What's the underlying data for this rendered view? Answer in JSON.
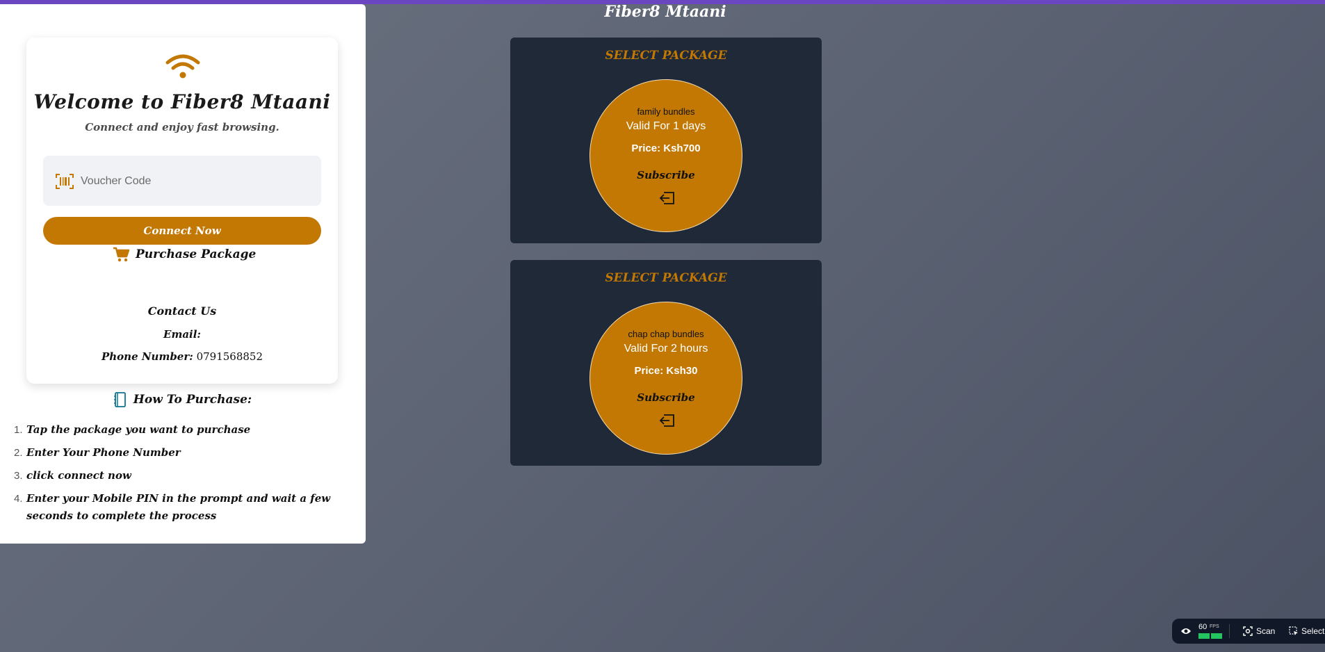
{
  "colors": {
    "accent": "#c27803",
    "card_bg": "#1f2937",
    "top_strip": "#6b46c1"
  },
  "login": {
    "title": "Welcome to Fiber8 Mtaani",
    "subtitle": "Connect and enjoy fast browsing.",
    "voucher_placeholder": "Voucher Code",
    "connect_label": "Connect Now",
    "purchase_label": "Purchase Package"
  },
  "contact": {
    "title": "Contact Us",
    "email_label": "Email:",
    "phone_label": "Phone Number:",
    "phone_value": "0791568852"
  },
  "howto": {
    "title": "How To Purchase:",
    "steps": [
      {
        "num": "1.",
        "text": "Tap the package you want to purchase"
      },
      {
        "num": "2.",
        "text": "Enter Your Phone Number"
      },
      {
        "num": "3.",
        "text": "click connect now"
      },
      {
        "num": "4.",
        "text": "Enter your Mobile PIN in the prompt and wait a few seconds to complete the process"
      }
    ]
  },
  "brand": "Fiber8 Mtaani",
  "packages": [
    {
      "heading": "SELECT PACKAGE",
      "name": "family bundles",
      "validity": "Valid For 1 days",
      "price": "Price: Ksh700",
      "action": "Subscribe"
    },
    {
      "heading": "SELECT PACKAGE",
      "name": "chap chap bundles",
      "validity": "Valid For 2 hours",
      "price": "Price: Ksh30",
      "action": "Subscribe"
    }
  ],
  "overlay": {
    "fps": "60",
    "fps_unit": "FPS",
    "scan": "Scan",
    "select": "Select"
  }
}
